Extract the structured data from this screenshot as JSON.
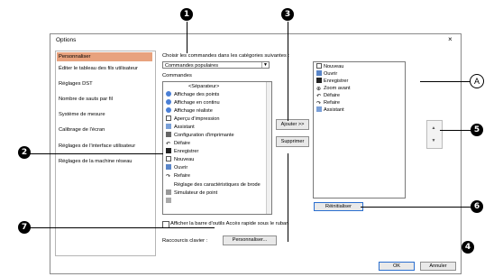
{
  "dialog": {
    "title": "Options",
    "close_glyph": "×"
  },
  "categories": [
    "Personnaliser",
    "Éditer le tableau des fils utilisateur",
    "Réglages DST",
    "Nombre de sauts par fil",
    "Système de mesure",
    "Calibrage de l'écran",
    "Réglages de l'interface utilisateur",
    "Réglages de la machine réseau"
  ],
  "customize": {
    "choose_label": "Choisir les commandes dans les catégories suivantes :",
    "category_value": "Commandes populaires",
    "commands_label": "Commandes",
    "commands": [
      "<Séparateur>",
      "Affichage des points",
      "Affichage en continu",
      "Affichage réaliste",
      "Aperçu d'impression",
      "Assistant",
      "Configuration d'imprimante",
      "Défaire",
      "Enregistrer",
      "Nouveau",
      "Ouvrir",
      "Refaire",
      "Réglage des caractéristiques de brode",
      "Simulateur de point"
    ],
    "add_button": "Ajouter >>",
    "remove_button": "Supprimer",
    "toolbar_items": [
      "Nouveau",
      "Ouvrir",
      "Enregistrer",
      "Zoom avant",
      "Défaire",
      "Refaire",
      "Assistant"
    ],
    "reset_button": "Réinitialiser",
    "quick_access_label": "Afficher la barre d'outils Accès rapide sous le ruban",
    "shortcut_label": "Raccourcis clavier :",
    "shortcut_button": "Personnaliser...",
    "up_glyph": "▲",
    "down_glyph": "▼"
  },
  "footer": {
    "ok": "OK",
    "cancel": "Annuler"
  },
  "callouts": {
    "n1": "1",
    "n2": "2",
    "n3": "3",
    "n4": "4",
    "n5": "5",
    "n6": "6",
    "n7": "7",
    "a": "A"
  },
  "colors": {
    "selection": "#e8a27e",
    "focus": "#2b6fcf"
  }
}
